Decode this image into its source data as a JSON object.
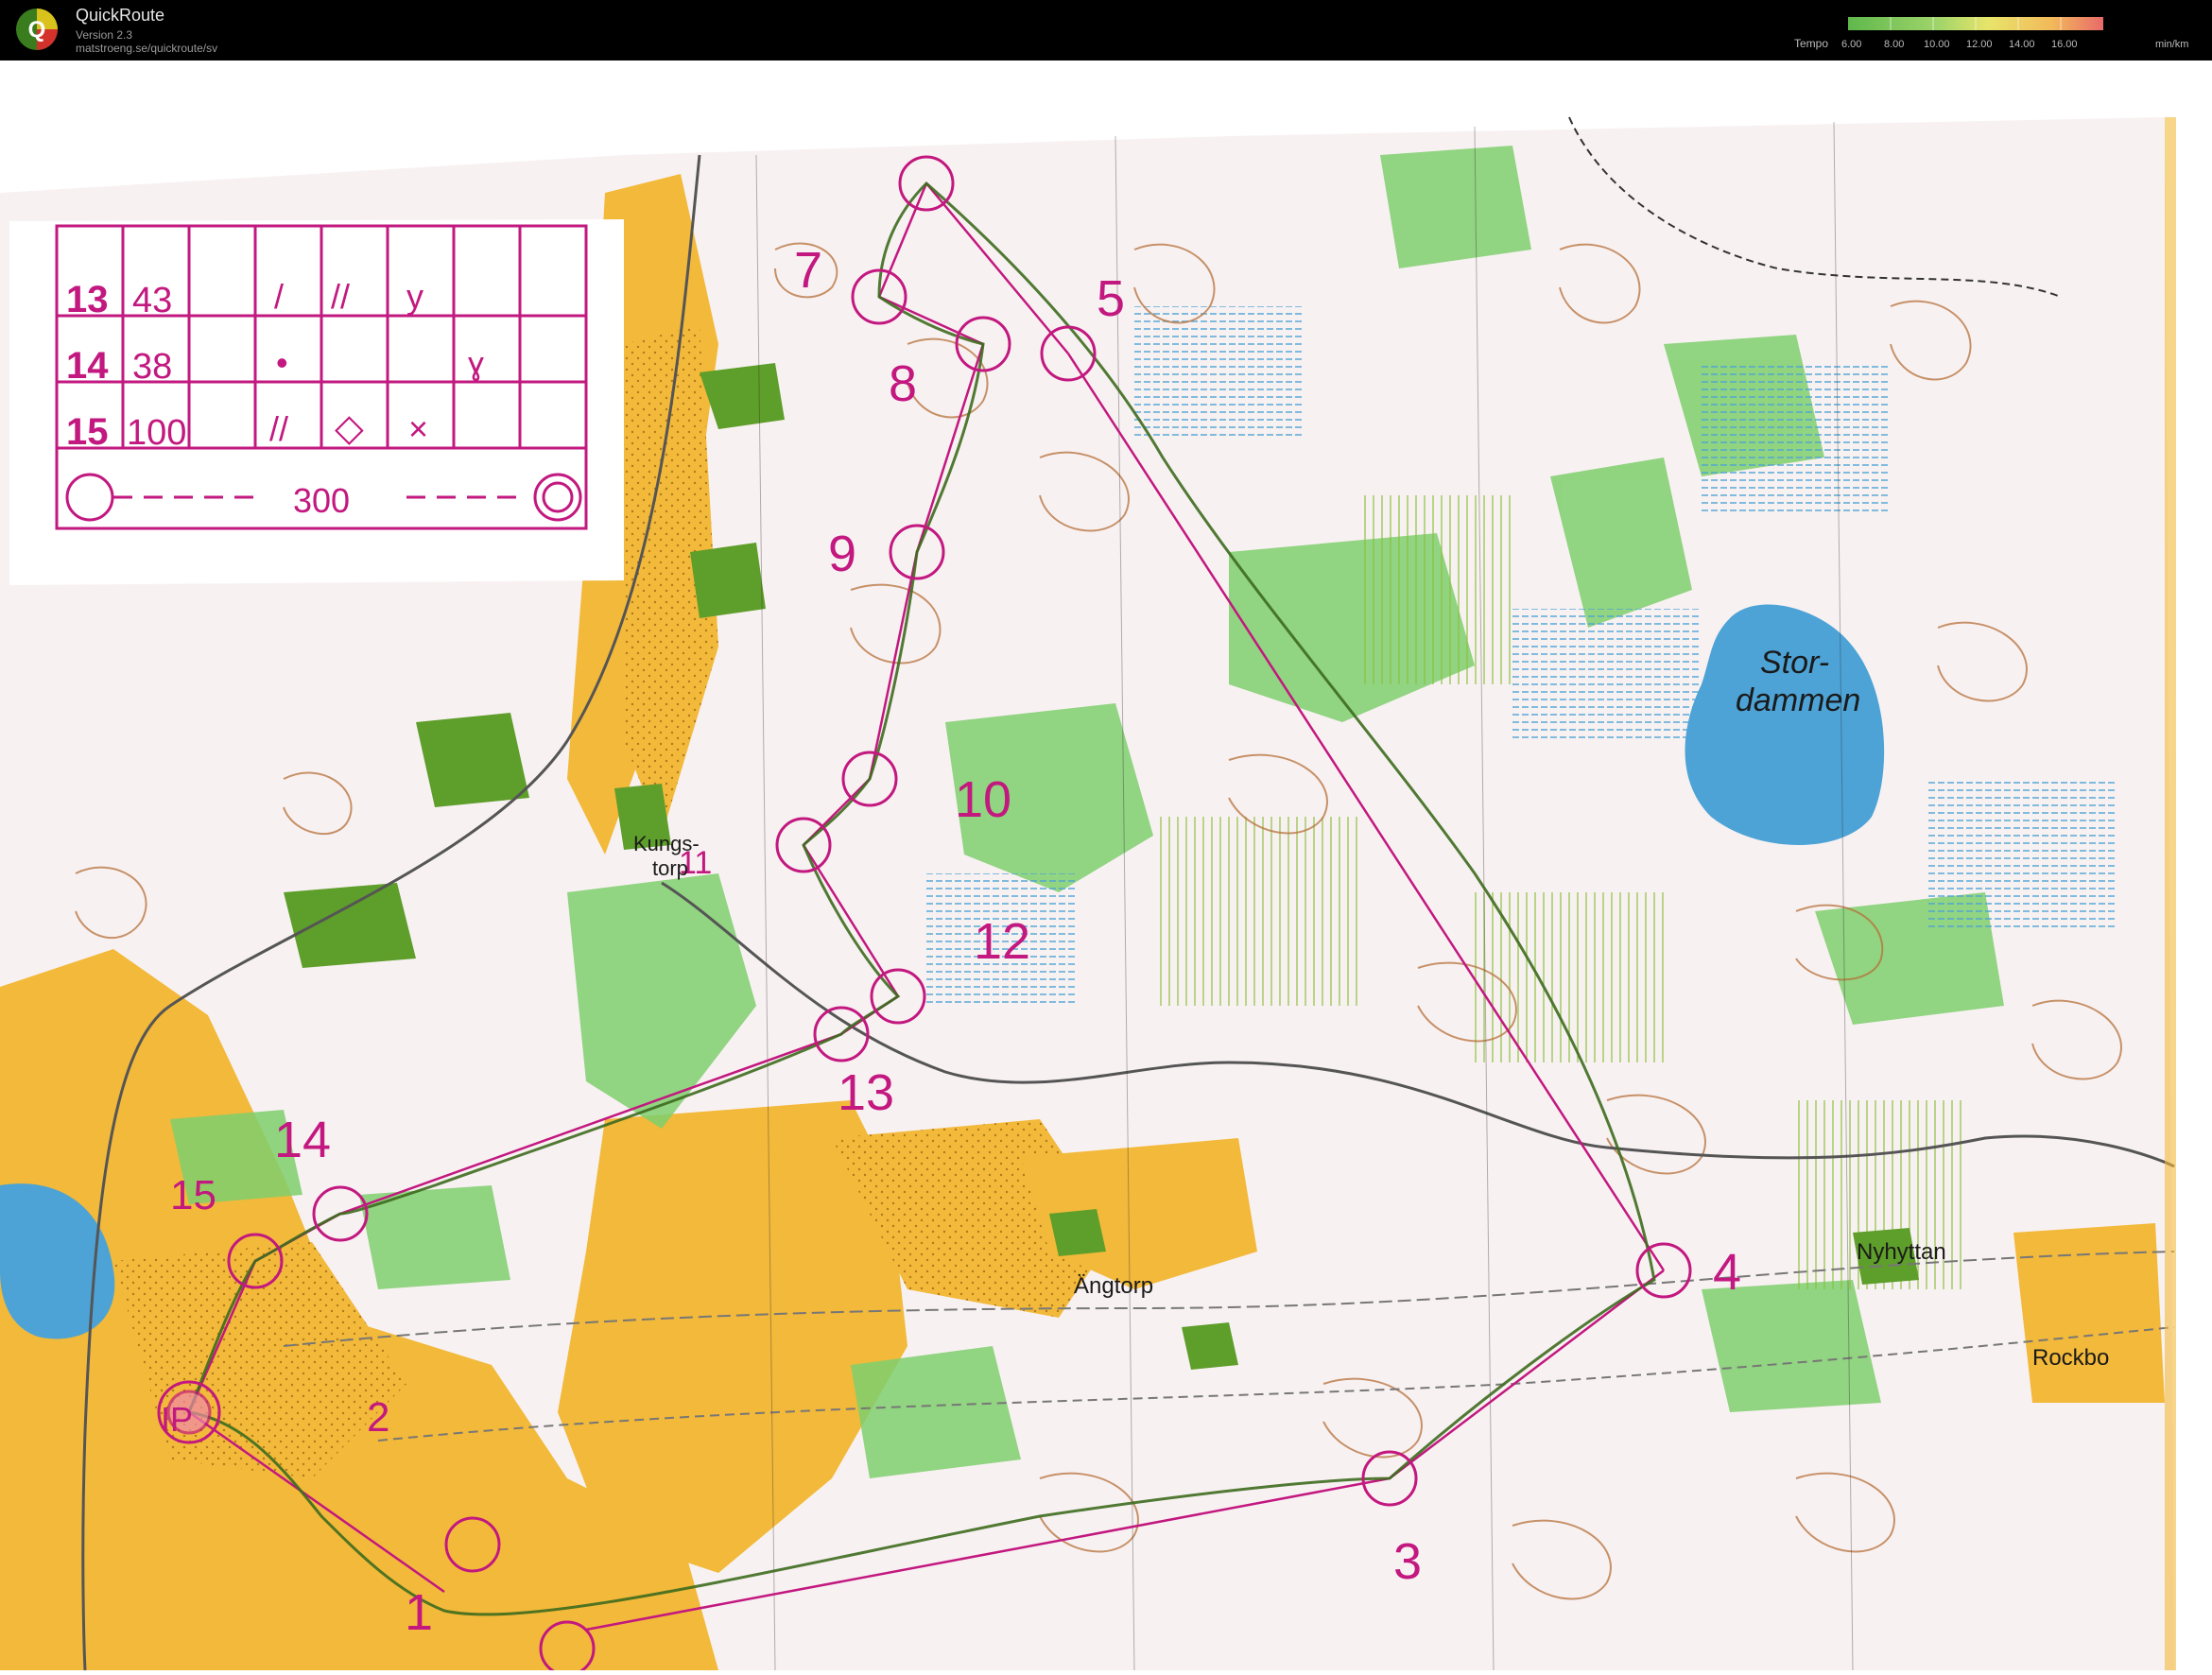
{
  "app": {
    "title": "QuickRoute",
    "version": "Version 2.3",
    "url": "matstroeng.se/quickroute/sv",
    "logo_letter": "Q"
  },
  "tempo_legend": {
    "label": "Tempo",
    "ticks": [
      "6.00",
      "8.00",
      "10.00",
      "12.00",
      "14.00",
      "16.00"
    ],
    "unit": "min/km"
  },
  "colors": {
    "course": "#c2187f",
    "route": "#3d6b1e",
    "open_land": "#f2b93a",
    "forest_green": "#7fcf6d",
    "water": "#4da3d6",
    "contour": "#b5703a",
    "paper": "#fdf8f8"
  },
  "description_table": {
    "rows": [
      {
        "num": "13",
        "code": "43",
        "symbols": [
          "/",
          "//",
          "y"
        ]
      },
      {
        "num": "14",
        "code": "38",
        "symbols": [
          "•",
          "",
          "ɣ"
        ]
      },
      {
        "num": "15",
        "code": "100",
        "symbols": [
          "//",
          "◇",
          "×"
        ]
      }
    ],
    "finish_distance": "300"
  },
  "controls": [
    {
      "label": "IP"
    },
    {
      "label": "1"
    },
    {
      "label": "2"
    },
    {
      "label": "3"
    },
    {
      "label": "4"
    },
    {
      "label": "5"
    },
    {
      "label": "7"
    },
    {
      "label": "8"
    },
    {
      "label": "9"
    },
    {
      "label": "10"
    },
    {
      "label": "11"
    },
    {
      "label": "12"
    },
    {
      "label": "13"
    },
    {
      "label": "14"
    },
    {
      "label": "15"
    }
  ],
  "place_names": {
    "lake_line1": "Stor-",
    "lake_line2": "dammen",
    "kungs1": "Kungs-",
    "kungs2": "torp",
    "angtorp": "Ängtorp",
    "nyhyttan": "Nyhyttan",
    "rockbo": "Rockbo"
  }
}
